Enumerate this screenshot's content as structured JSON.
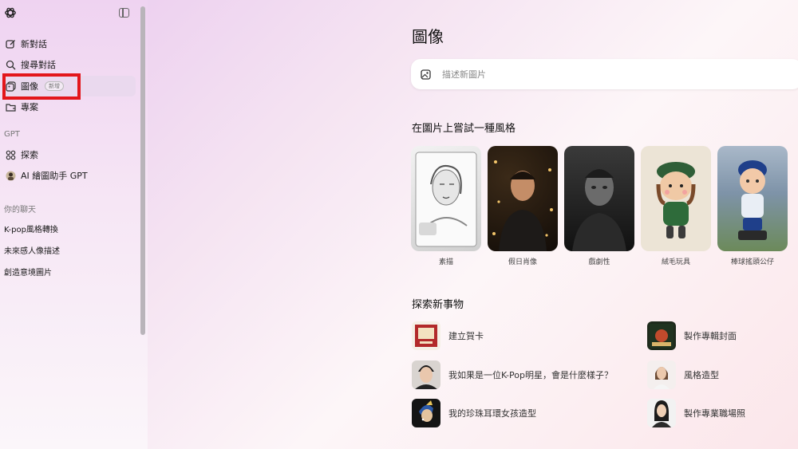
{
  "sidebar": {
    "items": [
      {
        "label": "新對話",
        "icon": "edit-icon"
      },
      {
        "label": "搜尋對話",
        "icon": "search-icon"
      },
      {
        "label": "圖像",
        "icon": "images-icon",
        "badge": "新增"
      },
      {
        "label": "專案",
        "icon": "folder-icon"
      }
    ],
    "gpt_section": "GPT",
    "gpt_items": [
      {
        "label": "探索",
        "icon": "grid-icon"
      },
      {
        "label": "AI 繪圖助手 GPT",
        "icon": "gpt-avatar-icon"
      }
    ],
    "chats_section": "你的聊天",
    "chats": [
      "K-pop風格轉換",
      "未來感人像描述",
      "創造意境圖片"
    ]
  },
  "main": {
    "title": "圖像",
    "search_placeholder": "描述新圖片",
    "styles_heading": "在圖片上嘗試一種風格",
    "styles": [
      {
        "label": "素描"
      },
      {
        "label": "假日肖像"
      },
      {
        "label": "戲劇性"
      },
      {
        "label": "絨毛玩具"
      },
      {
        "label": "棒球搖頭公仔"
      }
    ],
    "explore_heading": "探索新事物",
    "explore_left": [
      {
        "label": "建立賀卡"
      },
      {
        "label": "我如果是一位K-Pop明星，會是什麼樣子？"
      },
      {
        "label": "我的珍珠耳環女孩造型"
      }
    ],
    "explore_right": [
      {
        "label": "製作專輯封面"
      },
      {
        "label": "風格造型"
      },
      {
        "label": "製作專業職場照"
      }
    ]
  },
  "colors": {
    "highlight": "#e3161b",
    "active_item_bg": "#ead9ee"
  }
}
